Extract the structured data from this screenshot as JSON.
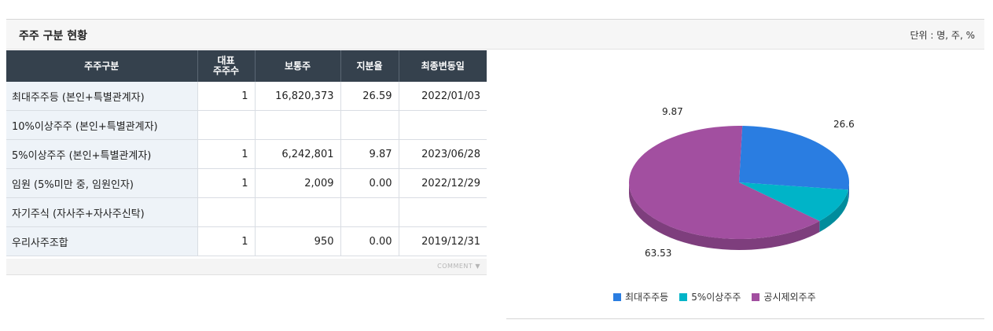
{
  "header": {
    "title": "주주 구분 현황",
    "unit": "단위 : 명, 주, %"
  },
  "table": {
    "columns": [
      "주주구분",
      "대표\n주주수",
      "보통주",
      "지분율",
      "최종변동일"
    ],
    "rows": [
      {
        "category": "최대주주등 (본인+특별관계자)",
        "count": "1",
        "shares": "16,820,373",
        "ratio": "26.59",
        "date": "2022/01/03"
      },
      {
        "category": "10%이상주주 (본인+특별관계자)",
        "count": "",
        "shares": "",
        "ratio": "",
        "date": ""
      },
      {
        "category": "5%이상주주 (본인+특별관계자)",
        "count": "1",
        "shares": "6,242,801",
        "ratio": "9.87",
        "date": "2023/06/28"
      },
      {
        "category": "임원 (5%미만 중, 임원인자)",
        "count": "1",
        "shares": "2,009",
        "ratio": "0.00",
        "date": "2022/12/29"
      },
      {
        "category": "자기주식 (자사주+자사주신탁)",
        "count": "",
        "shares": "",
        "ratio": "",
        "date": ""
      },
      {
        "category": "우리사주조합",
        "count": "1",
        "shares": "950",
        "ratio": "0.00",
        "date": "2019/12/31"
      }
    ],
    "comment_label": "COMMENT"
  },
  "chart_data": {
    "type": "pie",
    "slices": [
      {
        "name": "최대주주등",
        "value": 26.6,
        "label": "26.6",
        "color": "#2a7de1"
      },
      {
        "name": "5%이상주주",
        "value": 9.87,
        "label": "9.87",
        "color": "#00b4c8"
      },
      {
        "name": "공시제외주주",
        "value": 63.53,
        "label": "63.53",
        "color": "#a24fa0"
      }
    ],
    "legend_placement": "bottom",
    "three_d": true
  }
}
